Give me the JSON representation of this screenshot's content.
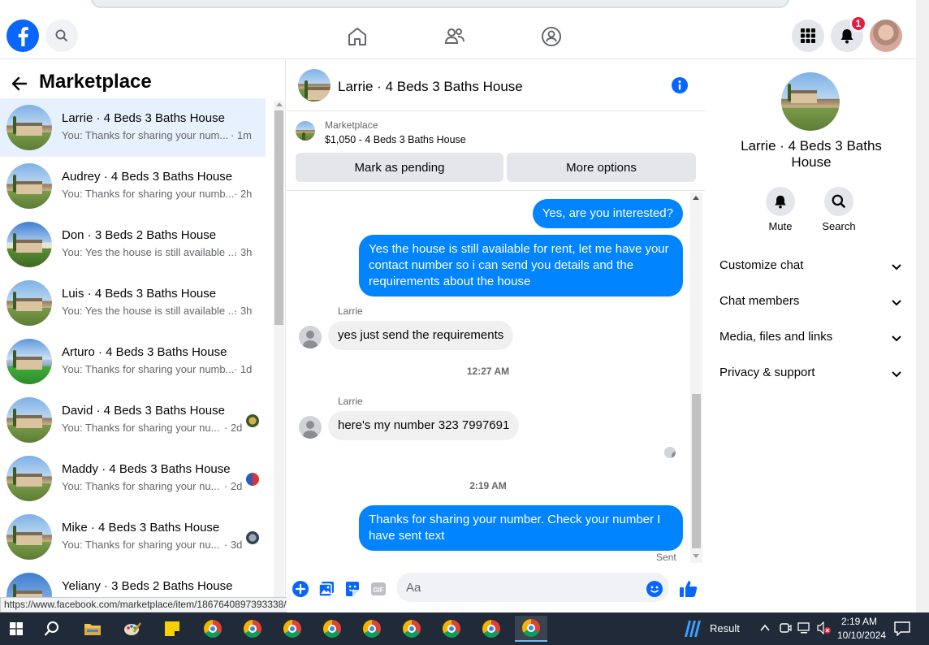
{
  "browser": {
    "status_url": "https://www.facebook.com/marketplace/item/1867640897393338/?r..."
  },
  "header": {
    "notification_count": "1"
  },
  "sidebar": {
    "title": "Marketplace",
    "conversations": [
      {
        "name": "Larrie · 4 Beds 3 Baths House",
        "preview": "You: Thanks for sharing your num...",
        "time": "· 1m",
        "active": true
      },
      {
        "name": "Audrey · 4 Beds 3 Baths House",
        "preview": "You: Thanks for sharing your numb...",
        "time": "· 2h"
      },
      {
        "name": "Don · 3 Beds 2 Baths House",
        "preview": "You: Yes the house is still available ...",
        "time": "· 3h"
      },
      {
        "name": "Luis · 4 Beds 3 Baths House",
        "preview": "You: Yes the house is still available ...",
        "time": "· 3h"
      },
      {
        "name": "Arturo · 4 Beds 3 Baths House",
        "preview": "You: Thanks for sharing your numb...",
        "time": "· 1d"
      },
      {
        "name": "David · 4 Beds 3 Baths House",
        "preview": "You: Thanks for sharing your nu...",
        "time": "· 2d"
      },
      {
        "name": "Maddy · 4 Beds 3 Baths House",
        "preview": "You: Thanks for sharing your nu...",
        "time": "· 2d"
      },
      {
        "name": "Mike · 4 Beds 3 Baths House",
        "preview": "You: Thanks for sharing your nu...",
        "time": "· 3d"
      },
      {
        "name": "Yeliany · 3 Beds 2 Baths House",
        "preview": "",
        "time": ""
      }
    ]
  },
  "chat": {
    "title": "Larrie · 4 Beds 3 Baths House",
    "listing_source": "Marketplace",
    "listing_summary": "$1,050 - 4 Beds 3 Baths House",
    "mark_pending_label": "Mark as pending",
    "more_options_label": "More options",
    "messages": {
      "m1": "Yes, are you interested?",
      "m2": "Yes the house is still available for rent, let me have your contact number so i can send you details and the requirements about the house",
      "sender1": "Larrie",
      "m3": "yes  just send the requirements",
      "time1": "12:27 AM",
      "sender2": "Larrie",
      "m4": "here's my number 323 7997691",
      "time2": "2:19 AM",
      "m5": "Thanks for sharing your number.  Check your number I have sent text",
      "status": "Sent"
    },
    "input_placeholder": "Aa"
  },
  "info": {
    "name": "Larrie · 4 Beds 3 Baths House",
    "mute_label": "Mute",
    "search_label": "Search",
    "rows": [
      "Customize chat",
      "Chat members",
      "Media, files and links",
      "Privacy & support"
    ]
  },
  "taskbar": {
    "widget_label": "Result",
    "time": "2:19 AM",
    "date": "10/10/2024"
  },
  "colors": {
    "brand": "#0866ff",
    "bubble_out": "#0084ff",
    "badge": "#e41e3f"
  }
}
